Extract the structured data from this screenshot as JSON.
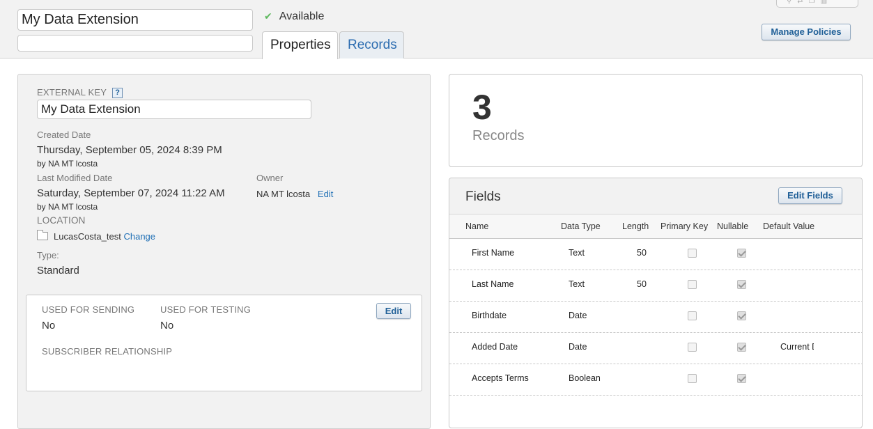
{
  "header": {
    "name_value": "My Data Extension",
    "description_value": "",
    "status": "Available",
    "tabs": [
      {
        "label": "Properties",
        "active": true
      },
      {
        "label": "Records",
        "active": false
      }
    ],
    "manage_policies": "Manage Policies"
  },
  "properties": {
    "external_key_label": "EXTERNAL KEY",
    "help_label": "?",
    "external_key_value": "My Data Extension",
    "created_date_label": "Created Date",
    "created_date": "Thursday, September 05, 2024 8:39 PM",
    "created_by": "by NA MT lcosta",
    "modified_date_label": "Last Modified Date",
    "modified_date": "Saturday, September 07, 2024 11:22 AM",
    "modified_by": "by NA MT lcosta",
    "owner_label": "Owner",
    "owner_value": "NA MT lcosta",
    "owner_edit": "Edit",
    "location_label": "LOCATION",
    "location_value": "LucasCosta_test",
    "location_change": "Change",
    "type_label": "Type:",
    "type_value": "Standard",
    "sending": {
      "used_for_sending_label": "USED FOR SENDING",
      "used_for_sending_value": "No",
      "used_for_testing_label": "USED FOR TESTING",
      "used_for_testing_value": "No",
      "subscriber_relationship_label": "SUBSCRIBER RELATIONSHIP",
      "edit_label": "Edit"
    }
  },
  "records": {
    "count": "3",
    "label": "Records"
  },
  "fields": {
    "title": "Fields",
    "edit_fields": "Edit Fields",
    "columns": [
      "Name",
      "Data Type",
      "Length",
      "Primary Key",
      "Nullable",
      "Default Value"
    ],
    "rows": [
      {
        "name": "First Name",
        "type": "Text",
        "length": "50",
        "primary_key": false,
        "nullable": true,
        "default": ""
      },
      {
        "name": "Last Name",
        "type": "Text",
        "length": "50",
        "primary_key": false,
        "nullable": true,
        "default": ""
      },
      {
        "name": "Birthdate",
        "type": "Date",
        "length": "",
        "primary_key": false,
        "nullable": true,
        "default": ""
      },
      {
        "name": "Added Date",
        "type": "Date",
        "length": "",
        "primary_key": false,
        "nullable": true,
        "default": "Current D"
      },
      {
        "name": "Accepts Terms",
        "type": "Boolean",
        "length": "",
        "primary_key": false,
        "nullable": true,
        "default": ""
      }
    ]
  },
  "colors": {
    "link": "#1f6fb5",
    "status_check": "#5cb85c",
    "panel_bg": "#f2f2f2"
  }
}
